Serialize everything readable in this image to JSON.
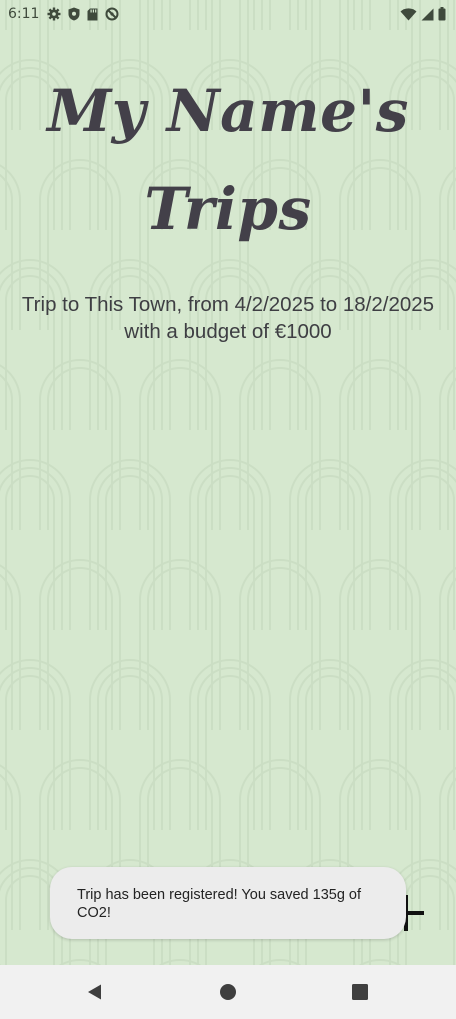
{
  "status_bar": {
    "time": "6:11",
    "left_icons": [
      "gear-icon",
      "shield-icon",
      "sd-card-icon",
      "no-sync-icon"
    ],
    "right_icons": [
      "wifi-icon",
      "signal-icon",
      "battery-icon"
    ]
  },
  "page": {
    "title_line1": "My Name's",
    "title_line2": "Trips",
    "trip_description": "Trip to This Town, from 4/2/2025 to 18/2/2025 with a budget of €1000"
  },
  "toast": {
    "message": "Trip has been registered! You saved 135g of CO2!"
  },
  "fab": {
    "icon": "plus-icon"
  },
  "nav_bar": {
    "icons": [
      "back-icon",
      "home-icon",
      "recents-icon"
    ]
  },
  "colors": {
    "background": "#d6e8cf",
    "title": "#434049",
    "toast_bg": "#ececec"
  }
}
